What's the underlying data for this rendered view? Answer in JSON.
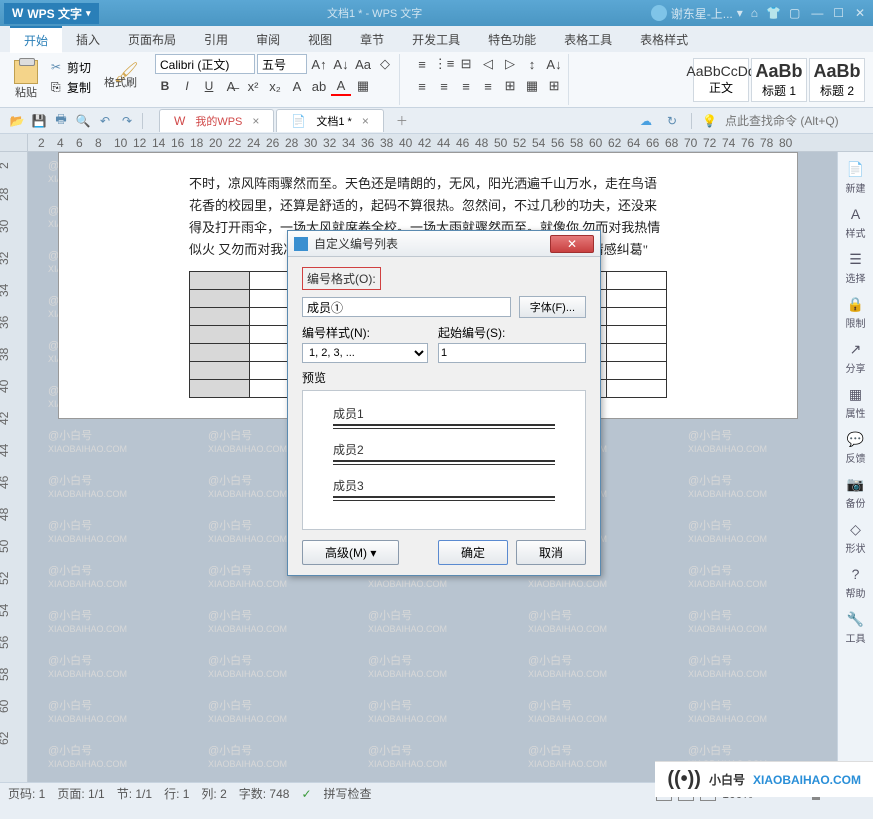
{
  "app": {
    "name": "WPS 文字",
    "doc_title": "文档1 * - WPS 文字",
    "user": "谢东星-上...",
    "search_placeholder": "点此查找命令 (Alt+Q)"
  },
  "menu": {
    "items": [
      "开始",
      "插入",
      "页面布局",
      "引用",
      "审阅",
      "视图",
      "章节",
      "开发工具",
      "特色功能",
      "表格工具",
      "表格样式"
    ],
    "active": 0
  },
  "ribbon": {
    "paste": "粘贴",
    "cut": "剪切",
    "copy": "复制",
    "format_painter": "格式刷",
    "font_name": "Calibri (正文)",
    "font_size": "五号",
    "styles": [
      {
        "sample": "AaBbCcDd",
        "name": "正文"
      },
      {
        "sample": "AaBb",
        "name": "标题 1"
      },
      {
        "sample": "AaBb",
        "name": "标题 2"
      }
    ]
  },
  "tabs": [
    {
      "label": "我的WPS",
      "type": "wps"
    },
    {
      "label": "文档1 *",
      "type": "doc"
    }
  ],
  "document": {
    "paragraph": "不时，凉风阵雨骤然而至。天色还是晴朗的，无风，阳光洒遍千山万水，走在鸟语花香的校园里，还算是舒适的，起码不算很热。忽然间，不过几秒的功夫，还没来得及打开雨伞，一场大风就席卷全校。一场大雨就骤然而至。就像你   勿而对我热情似火    又勿而对我冷若冰霜。后来，我才明白                                                    我们都陷入了一场错误的\"情感纠葛\""
  },
  "sidepanel": {
    "items": [
      {
        "icon": "📄",
        "label": "新建"
      },
      {
        "icon": "A",
        "label": "样式"
      },
      {
        "icon": "☰",
        "label": "选择"
      },
      {
        "icon": "🔒",
        "label": "限制"
      },
      {
        "icon": "↗",
        "label": "分享"
      },
      {
        "icon": "▦",
        "label": "属性"
      },
      {
        "icon": "💬",
        "label": "反馈"
      },
      {
        "icon": "📷",
        "label": "备份"
      },
      {
        "icon": "◇",
        "label": "形状"
      },
      {
        "icon": "?",
        "label": "帮助"
      },
      {
        "icon": "🔧",
        "label": "工具"
      }
    ]
  },
  "dialog": {
    "title": "自定义编号列表",
    "format_label": "编号格式(O):",
    "member_value": "成员①",
    "font_btn": "字体(F)...",
    "style_label": "编号样式(N):",
    "style_value": "1, 2, 3, ...",
    "start_label": "起始编号(S):",
    "start_value": "1",
    "preview_label": "预览",
    "preview_items": [
      "成员1",
      "成员2",
      "成员3"
    ],
    "advanced": "高级(M) ▾",
    "ok": "确定",
    "cancel": "取消"
  },
  "status": {
    "page_num": "页码: 1",
    "page": "页面: 1/1",
    "section": "节: 1/1",
    "line": "行: 1",
    "col": "列: 2",
    "words": "字数: 748",
    "spell": "拼写检查",
    "zoom": "100%"
  },
  "brand": {
    "name": "小白号",
    "domain": "XIAOBAIHAO.COM"
  },
  "ruler_h": [
    2,
    4,
    6,
    8,
    10,
    12,
    14,
    16,
    18,
    20,
    22,
    24,
    26,
    28,
    30,
    32,
    34,
    36,
    38,
    40,
    42,
    44,
    46,
    48,
    50,
    52,
    54,
    56,
    58,
    60,
    62,
    64,
    66,
    68,
    70,
    72,
    74,
    76,
    78,
    80
  ],
  "ruler_v": [
    2,
    28,
    30,
    32,
    34,
    36,
    38,
    40,
    42,
    44,
    46,
    48,
    50,
    52,
    54,
    56,
    58,
    60,
    62
  ]
}
